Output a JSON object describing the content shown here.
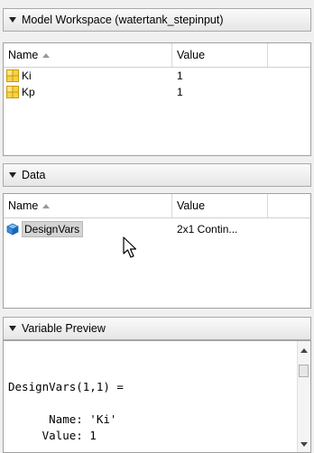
{
  "model_workspace": {
    "title": "Model Workspace (watertank_stepinput)",
    "columns": {
      "name": "Name",
      "value": "Value"
    },
    "rows": [
      {
        "name": "Ki",
        "value": "1"
      },
      {
        "name": "Kp",
        "value": "1"
      }
    ]
  },
  "data_panel": {
    "title": "Data",
    "columns": {
      "name": "Name",
      "value": "Value"
    },
    "rows": [
      {
        "name": "DesignVars",
        "value": "2x1 Contin..."
      }
    ]
  },
  "variable_preview": {
    "title": "Variable Preview",
    "text": "DesignVars(1,1) =\n\n      Name: 'Ki'\n     Value: 1"
  },
  "colors": {
    "header_bg": "#e9e9e9",
    "selection_bg": "#d4d4d4",
    "icon_grid": "#f2c200",
    "icon_cube": "#2a7dd1"
  },
  "icons": {
    "collapse": "triangle-down-icon",
    "sort": "sort-ascending-icon",
    "variable": "table-grid-icon",
    "object": "cube-icon",
    "cursor": "mouse-pointer-icon"
  }
}
